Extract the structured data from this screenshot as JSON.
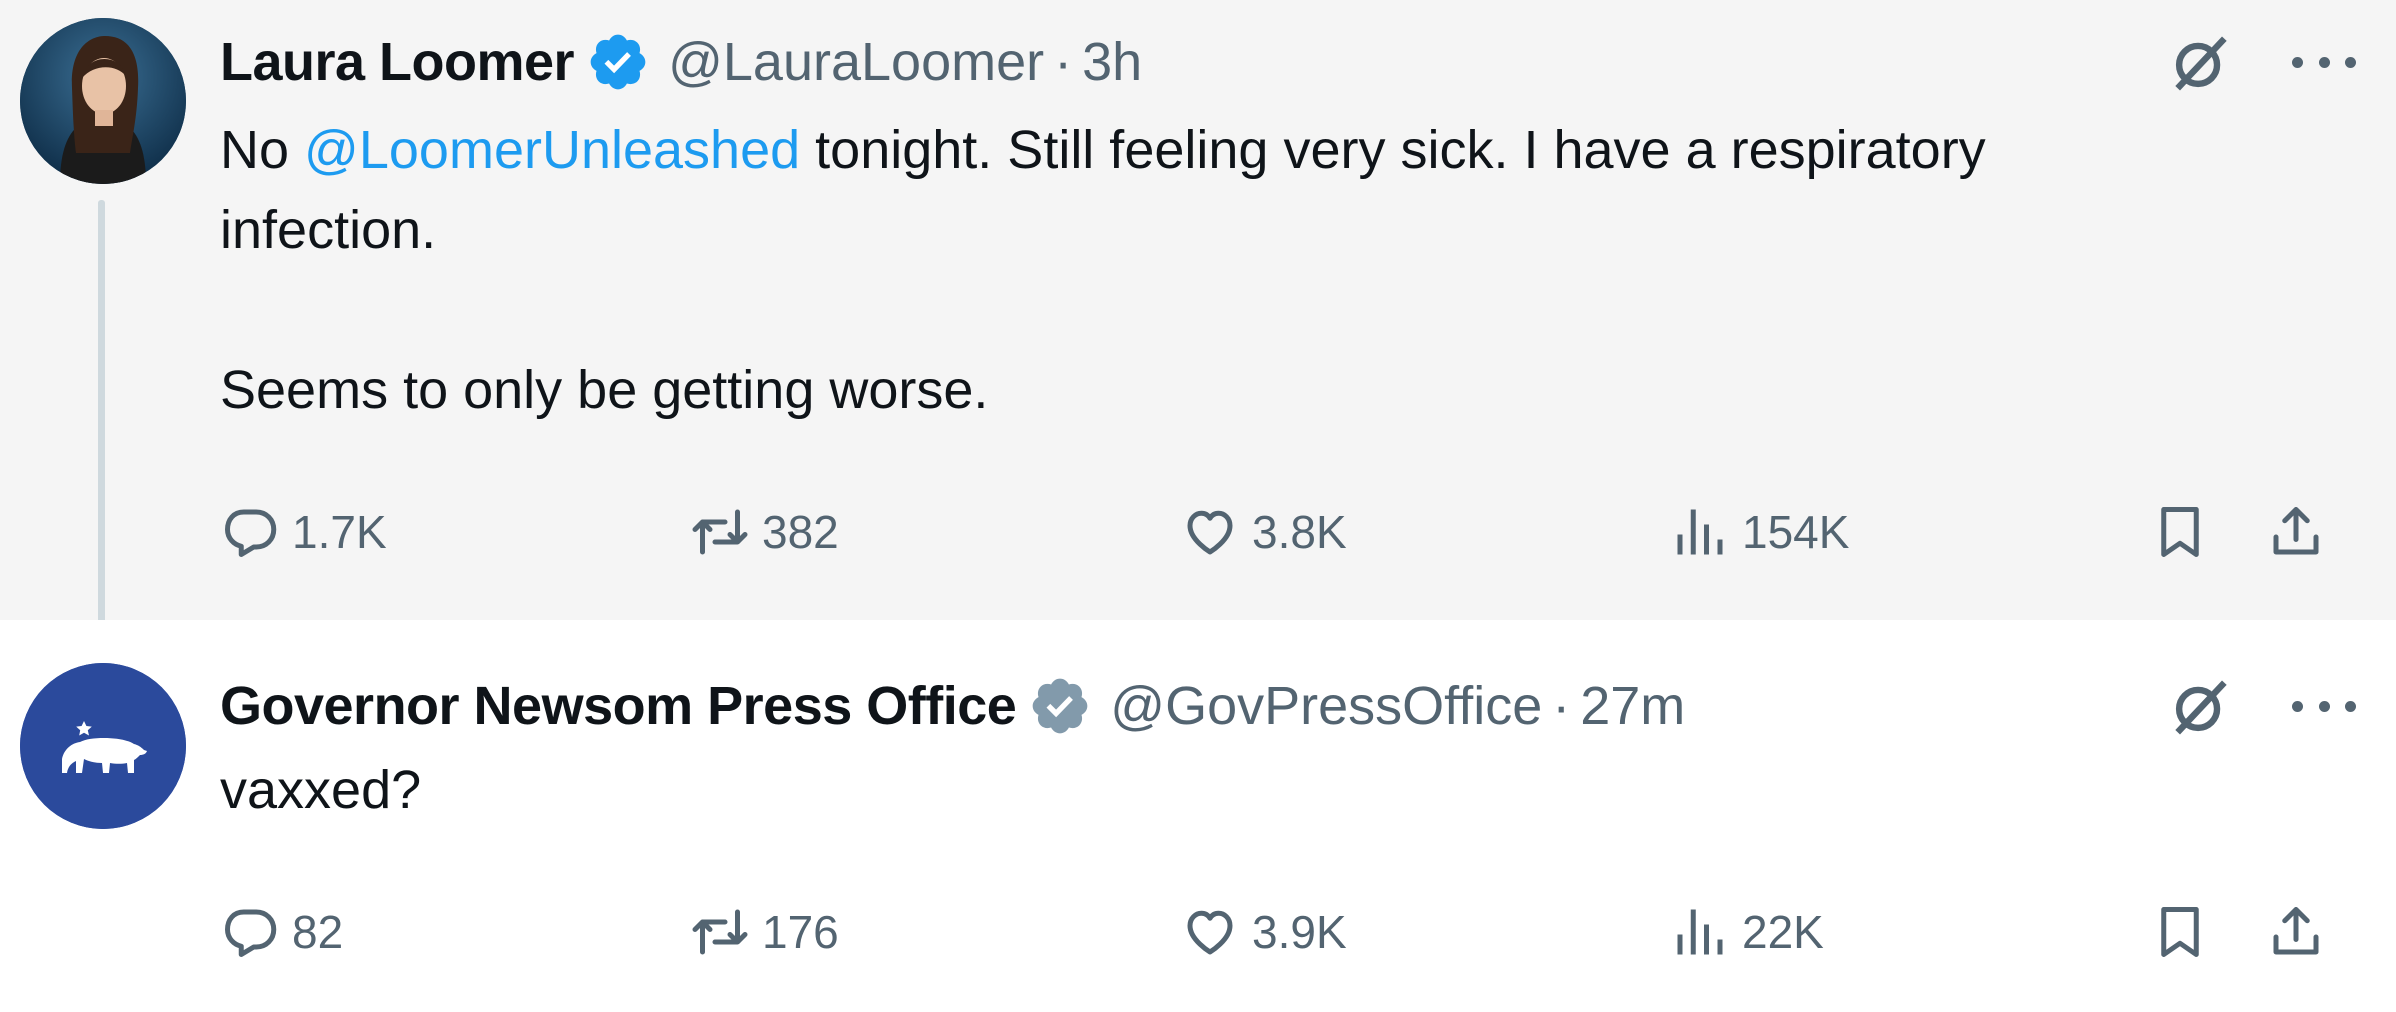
{
  "tweets": [
    {
      "author_name": "Laura Loomer",
      "handle": "@LauraLoomer",
      "separator": "·",
      "time": "3h",
      "verified_color": "#1d9bf0",
      "text_mention": "@LoomerUnleashed",
      "text_line1_prefix": "No ",
      "text_line1_suffix": " tonight. Still feeling very sick. I have a respiratory",
      "text_line2": "infection.",
      "text_line3": "Seems to only be getting worse.",
      "replies": "1.7K",
      "reposts": "382",
      "likes": "3.8K",
      "views": "154K"
    },
    {
      "author_name": "Governor Newsom Press Office",
      "handle": "@GovPressOffice",
      "separator": "·",
      "time": "27m",
      "verified_color": "#829aab",
      "text_line1": "vaxxed?",
      "replies": "82",
      "reposts": "176",
      "likes": "3.9K",
      "views": "22K"
    }
  ],
  "icons": {
    "verified": "verified-badge-icon",
    "grok": "grok-icon",
    "more": "more-icon",
    "reply": "reply-icon",
    "repost": "repost-icon",
    "like": "like-icon",
    "views": "views-icon",
    "bookmark": "bookmark-icon",
    "share": "share-icon"
  },
  "colors": {
    "mention": "#1d9bf0",
    "secondary_text": "#536471",
    "thread_line": "#cfd9de",
    "upper_bg": "#f5f5f5"
  }
}
